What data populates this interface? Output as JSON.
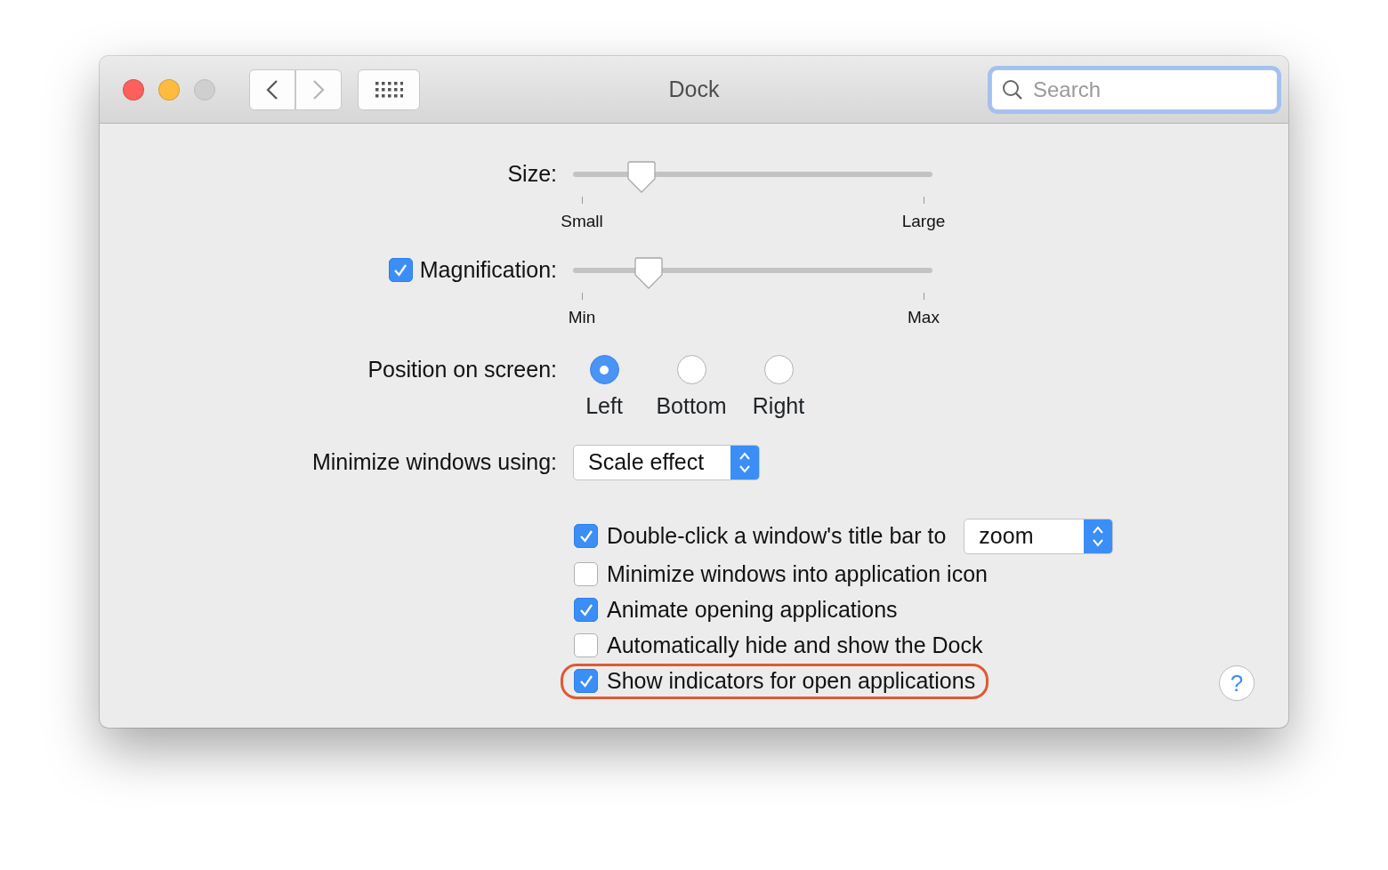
{
  "window": {
    "title": "Dock",
    "buttons": [
      {
        "kind": "close",
        "disabled": false
      },
      {
        "kind": "minimize",
        "disabled": false
      },
      {
        "kind": "zoom",
        "disabled": true
      }
    ]
  },
  "toolbar": {
    "back_disabled": false,
    "forward_disabled": true
  },
  "search": {
    "placeholder": "Search",
    "focused": true
  },
  "size": {
    "label": "Size:",
    "level": 0.19,
    "min_label": "Small",
    "max_label": "Large"
  },
  "magnification": {
    "label": "Magnification:",
    "checked": true,
    "level": 0.21,
    "min_label": "Min",
    "max_label": "Max"
  },
  "position": {
    "label": "Position on screen:",
    "options": [
      {
        "label": "Left",
        "selected": true
      },
      {
        "label": "Bottom",
        "selected": false
      },
      {
        "label": "Right",
        "selected": false
      }
    ]
  },
  "minimize_effect": {
    "label": "Minimize windows using:",
    "value": "Scale effect"
  },
  "options": [
    {
      "kind": "checkbox-popup",
      "label": "Double-click a window's title bar to",
      "checked": true,
      "value": "zoom",
      "highlighted": false
    },
    {
      "kind": "checkbox",
      "label": "Minimize windows into application icon",
      "checked": false,
      "highlighted": false
    },
    {
      "kind": "checkbox",
      "label": "Animate opening applications",
      "checked": true,
      "highlighted": false
    },
    {
      "kind": "checkbox",
      "label": "Automatically hide and show the Dock",
      "checked": false,
      "highlighted": false
    },
    {
      "kind": "checkbox",
      "label": "Show indicators for open applications",
      "checked": true,
      "highlighted": true
    }
  ],
  "help": {
    "label": "?"
  }
}
